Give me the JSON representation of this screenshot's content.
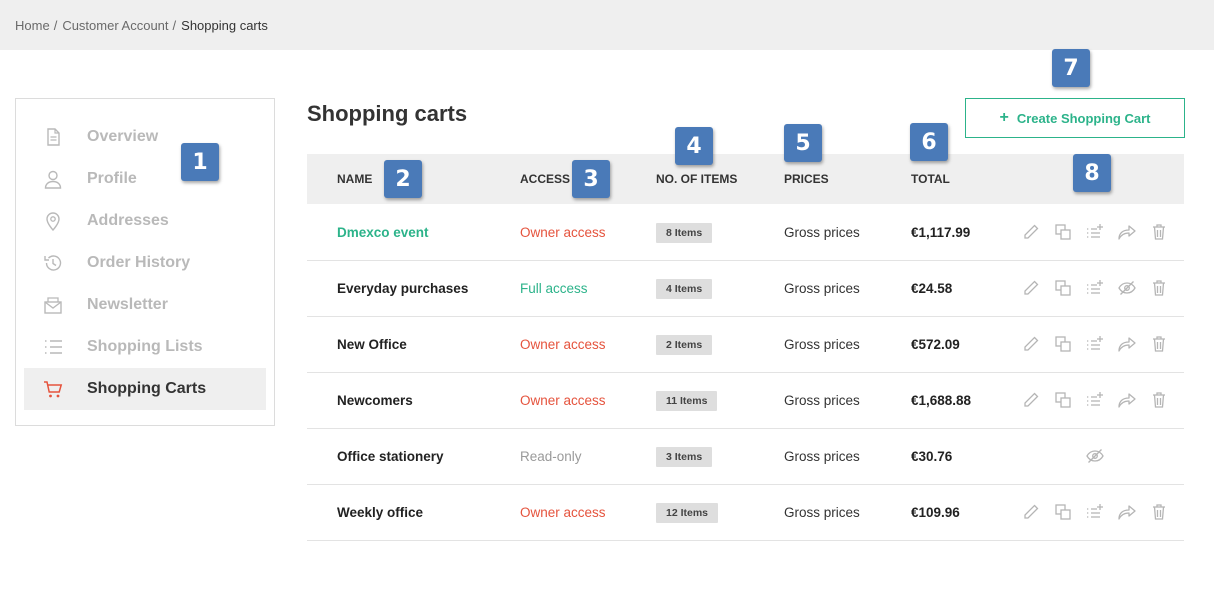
{
  "breadcrumb": {
    "items": [
      "Home",
      "Customer Account",
      "Shopping carts"
    ],
    "separator": "/"
  },
  "sidebar": {
    "items": [
      {
        "label": "Overview",
        "icon": "document-icon"
      },
      {
        "label": "Profile",
        "icon": "user-icon"
      },
      {
        "label": "Addresses",
        "icon": "map-pin-icon"
      },
      {
        "label": "Order History",
        "icon": "history-icon"
      },
      {
        "label": "Newsletter",
        "icon": "newsletter-icon"
      },
      {
        "label": "Shopping Lists",
        "icon": "list-icon"
      },
      {
        "label": "Shopping Carts",
        "icon": "cart-icon",
        "active": true
      }
    ]
  },
  "page": {
    "title": "Shopping carts",
    "create_button_label": "Create Shopping Cart",
    "create_button_icon": "plus-icon"
  },
  "table": {
    "headers": [
      "NAME",
      "ACCESS",
      "NO. OF ITEMS",
      "PRICES",
      "TOTAL"
    ],
    "rows": [
      {
        "name": "Dmexco event",
        "access": "Owner access",
        "items": "8 Items",
        "prices": "Gross prices",
        "total": "€1,117.99",
        "actions": [
          "edit",
          "duplicate",
          "add-to-list",
          "share",
          "delete"
        ]
      },
      {
        "name": "Everyday purchases",
        "access": "Full access",
        "items": "4 Items",
        "prices": "Gross prices",
        "total": "€24.58",
        "actions": [
          "edit",
          "duplicate",
          "add-to-list",
          "hide",
          "delete"
        ]
      },
      {
        "name": "New Office",
        "access": "Owner access",
        "items": "2 Items",
        "prices": "Gross prices",
        "total": "€572.09",
        "actions": [
          "edit",
          "duplicate",
          "add-to-list",
          "share",
          "delete"
        ]
      },
      {
        "name": "Newcomers",
        "access": "Owner access",
        "items": "11 Items",
        "prices": "Gross prices",
        "total": "€1,688.88",
        "actions": [
          "edit",
          "duplicate",
          "add-to-list",
          "share",
          "delete"
        ]
      },
      {
        "name": "Office stationery",
        "access": "Read-only",
        "items": "3 Items",
        "prices": "Gross prices",
        "total": "€30.76",
        "actions": [
          "hide"
        ]
      },
      {
        "name": "Weekly office",
        "access": "Owner access",
        "items": "12 Items",
        "prices": "Gross prices",
        "total": "€109.96",
        "actions": [
          "edit",
          "duplicate",
          "add-to-list",
          "share",
          "delete"
        ]
      }
    ]
  },
  "callouts": [
    "1",
    "2",
    "3",
    "4",
    "5",
    "6",
    "7",
    "8"
  ],
  "colors": {
    "accent_green": "#2cb38a",
    "owner_red": "#e5533d",
    "readonly_gray": "#9a9a9a",
    "callout_blue": "#4a7ab8",
    "header_bg": "#efefef"
  }
}
